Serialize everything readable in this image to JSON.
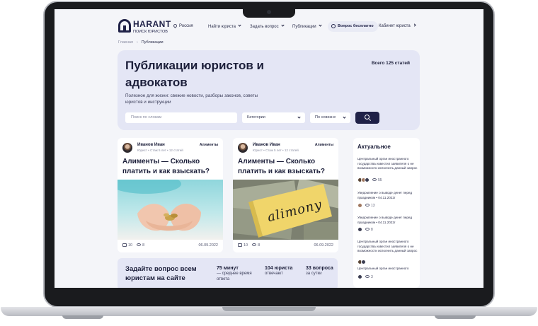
{
  "header": {
    "brand": "HARANT",
    "brand_sub": "ПОИСК ЮРИСТОВ",
    "region": "Россия",
    "nav": [
      "Найти юриста",
      "Задать вопрос",
      "Публикации"
    ],
    "ask_free": "Вопрос бесплатно",
    "cabinet": "Кабинет юриста"
  },
  "breadcrumb": {
    "home": "Главная",
    "current": "Публикации"
  },
  "hero": {
    "title": "Публикации юристов и адвокатов",
    "description": "Полезное для жизни: свежие новости, разборы законов, советы юристов и инструкции",
    "total": "Всего 125 статей",
    "search_placeholder": "Поиск по словам",
    "category_select": "Категории",
    "sort_select": "По новизне"
  },
  "cards": [
    {
      "author": "Иванов Иван",
      "meta": "Юрист • Стаж 5 лет • 12 статей",
      "category": "Алименты",
      "title": "Алименты — Сколько платить и как взыскать?",
      "likes": "10",
      "views": "8",
      "date": "06.09.2022"
    },
    {
      "author": "Иванов Иван",
      "meta": "Юрист • Стаж 5 лет • 12 статей",
      "category": "Алименты",
      "title": "Алименты — Сколько платить и как взыскать?",
      "image_text": "alimony",
      "likes": "10",
      "views": "8",
      "date": "06.09.2022"
    }
  ],
  "cta": {
    "title": "Задайте вопрос всем юристам на сайте",
    "stats": [
      {
        "value": "75 минут",
        "label": "— среднее время ответа"
      },
      {
        "value": "104 юриста",
        "label": "отвечают"
      },
      {
        "value": "33 вопроса",
        "label": "за сутки"
      }
    ]
  },
  "sidebar": {
    "title": "Актуальное",
    "items": [
      {
        "text": "Центральный орган иностранного государства известил заявителя о не возможности исполнить данный запрос",
        "views": "55"
      },
      {
        "text": "Уведомление о выводе денег перед праздником • 04.11.2022г",
        "views": "13"
      },
      {
        "text": "Уведомление о выводе денег перед праздником • 04.11.2022г",
        "views": "8"
      },
      {
        "text": "Центральный орган иностранного государства известил заявителя о не возможности исполнить данный запрос",
        "views": ""
      },
      {
        "text": "Центральный орган иностранного",
        "views": "3"
      }
    ]
  }
}
